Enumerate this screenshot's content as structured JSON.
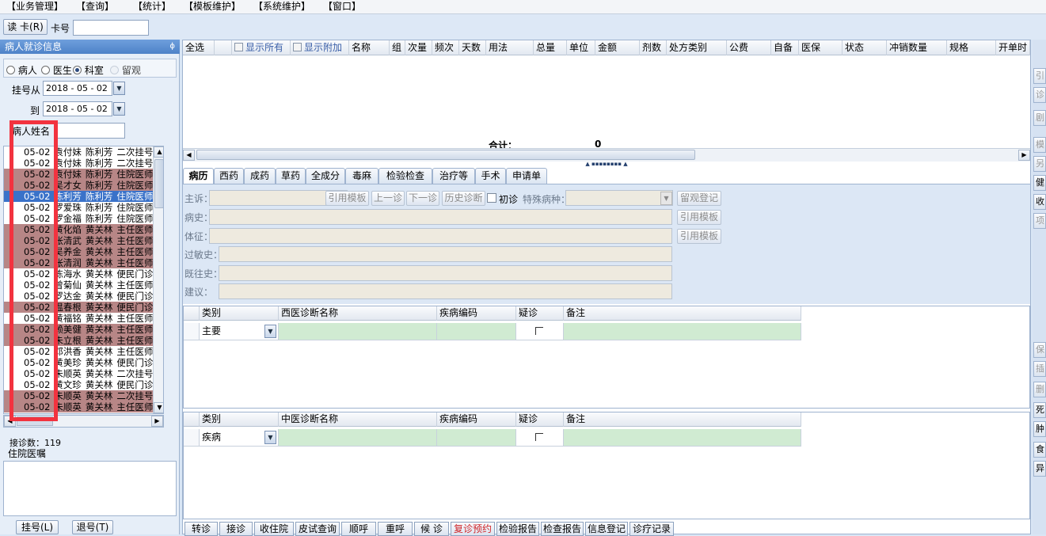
{
  "menu": [
    "【业务管理】",
    "【查询】",
    "【统计】",
    "【模板维护】",
    "【系统维护】",
    "【窗口】"
  ],
  "topbar": {
    "read_card": "读 卡(R)",
    "card_no_label": "卡号",
    "card_no_value": ""
  },
  "left": {
    "title": "病人就诊信息",
    "pin": "ɸ",
    "radios": [
      {
        "label": "病人",
        "on": false
      },
      {
        "label": "医生",
        "on": true
      },
      {
        "label": "科室",
        "on": false
      },
      {
        "label": "留观",
        "on": false
      }
    ],
    "reg_from_label": "挂号从",
    "reg_from": "2018 - 05 - 02",
    "reg_to_label": "到",
    "reg_to": "2018 - 05 - 02",
    "patient_name_label": "病人姓名",
    "patients": [
      {
        "date": "05-02",
        "name": "袁付妹",
        "doctor": "陈利芳",
        "type": "二次挂号",
        "style": "normal"
      },
      {
        "date": "05-02",
        "name": "袁付妹",
        "doctor": "陈利芳",
        "type": "二次挂号",
        "style": "normal"
      },
      {
        "date": "05-02",
        "name": "袁付妹",
        "doctor": "陈利芳",
        "type": "住院医师号",
        "style": "dark"
      },
      {
        "date": "05-02",
        "name": "吴才女",
        "doctor": "陈利芳",
        "type": "住院医师号",
        "style": "dark"
      },
      {
        "date": "05-02",
        "name": "陈利芳",
        "doctor": "陈利芳",
        "type": "住院医师号",
        "style": "sel"
      },
      {
        "date": "05-02",
        "name": "罗爱珠",
        "doctor": "陈利芳",
        "type": "住院医师号",
        "style": "normal"
      },
      {
        "date": "05-02",
        "name": "罗金福",
        "doctor": "陈利芳",
        "type": "住院医师号",
        "style": "normal"
      },
      {
        "date": "05-02",
        "name": "黄化焰",
        "doctor": "黄关林",
        "type": "主任医师号",
        "style": "dark"
      },
      {
        "date": "05-02",
        "name": "张清武",
        "doctor": "黄关林",
        "type": "主任医师号",
        "style": "dark"
      },
      {
        "date": "05-02",
        "name": "吴养金",
        "doctor": "黄关林",
        "type": "主任医师号",
        "style": "dark"
      },
      {
        "date": "05-02",
        "name": "张清润",
        "doctor": "黄关林",
        "type": "主任医师号",
        "style": "dark"
      },
      {
        "date": "05-02",
        "name": "陈海水",
        "doctor": "黄关林",
        "type": "便民门诊号",
        "style": "normal"
      },
      {
        "date": "05-02",
        "name": "曾菊仙",
        "doctor": "黄关林",
        "type": "主任医师号",
        "style": "normal"
      },
      {
        "date": "05-02",
        "name": "罗达金",
        "doctor": "黄关林",
        "type": "便民门诊号",
        "style": "normal"
      },
      {
        "date": "05-02",
        "name": "温春根",
        "doctor": "黄关林",
        "type": "便民门诊号",
        "style": "dark"
      },
      {
        "date": "05-02",
        "name": "黄福铭",
        "doctor": "黄关林",
        "type": "主任医师号",
        "style": "normal"
      },
      {
        "date": "05-02",
        "name": "赖美健",
        "doctor": "黄关林",
        "type": "主任医师号",
        "style": "dark"
      },
      {
        "date": "05-02",
        "name": "朱立根",
        "doctor": "黄关林",
        "type": "主任医师号",
        "style": "dark"
      },
      {
        "date": "05-02",
        "name": "邓洪香",
        "doctor": "黄关林",
        "type": "主任医师号",
        "style": "normal"
      },
      {
        "date": "05-02",
        "name": "黄美珍",
        "doctor": "黄关林",
        "type": "便民门诊号",
        "style": "normal"
      },
      {
        "date": "05-02",
        "name": "朱顺英",
        "doctor": "黄关林",
        "type": "二次挂号",
        "style": "normal"
      },
      {
        "date": "05-02",
        "name": "黄文珍",
        "doctor": "黄关林",
        "type": "便民门诊号",
        "style": "normal"
      },
      {
        "date": "05-02",
        "name": "朱顺英",
        "doctor": "黄关林",
        "type": "二次挂号",
        "style": "dark"
      },
      {
        "date": "05-02",
        "name": "朱顺英",
        "doctor": "黄关林",
        "type": "主任医师号",
        "style": "dark"
      }
    ],
    "visit_count": "接诊数：119",
    "inpatient_order": "住院医嘱",
    "register_btn": "挂号(L)",
    "unregister_btn": "退号(T)"
  },
  "rx_grid": {
    "headers": [
      "全选",
      "显示所有",
      "显示附加",
      "名称",
      "组",
      "次量",
      "频次",
      "天数",
      "用法",
      "总量",
      "单位",
      "金额",
      "剂数",
      "处方类别",
      "公费",
      "自备",
      "医保",
      "状态",
      "冲销数量",
      "规格",
      "开单时"
    ],
    "total_label": "合计：",
    "total_value": "0"
  },
  "tabs": [
    "病历",
    "西药",
    "成药",
    "草药",
    "全成分",
    "毒麻",
    "检验检查",
    "治疗等",
    "手术",
    "申请单"
  ],
  "emr": {
    "chief_label": "主诉：",
    "cite_template": "引用模板",
    "prev_visit": "上一诊",
    "next_visit": "下一诊",
    "history_diag": "历史诊断",
    "first_visit": "初诊",
    "special_label": "特殊病种：",
    "observe_reg": "留观登记",
    "history_label": "病史：",
    "sign_label": "体征：",
    "allergy_label": "过敏史：",
    "past_label": "既往史：",
    "advice_label": "建议："
  },
  "west_diag": {
    "headers": [
      "类别",
      "西医诊断名称",
      "疾病编码",
      "疑诊",
      "备注"
    ],
    "row_category": "主要"
  },
  "cn_diag": {
    "headers": [
      "类别",
      "中医诊断名称",
      "疾病编码",
      "疑诊",
      "备注"
    ],
    "row_category": "疾病"
  },
  "bottom_buttons": [
    "转诊",
    "接诊",
    "收住院",
    "皮试查询",
    "顺呼",
    "重呼",
    "候 诊",
    "复诊预约",
    "检验报告",
    "检查报告",
    "信息登记",
    "诊疗记录"
  ],
  "right_buttons": [
    "引",
    "诊",
    "剧",
    "模",
    "另",
    "健",
    "收",
    "项",
    "保",
    "插",
    "删",
    "死",
    "肿",
    "食",
    "异"
  ],
  "colors": {
    "selected_row": "#3a72c9",
    "dark_row": "#b78686",
    "highlight_box": "#f2333f",
    "recall_red": "#d0262a"
  }
}
